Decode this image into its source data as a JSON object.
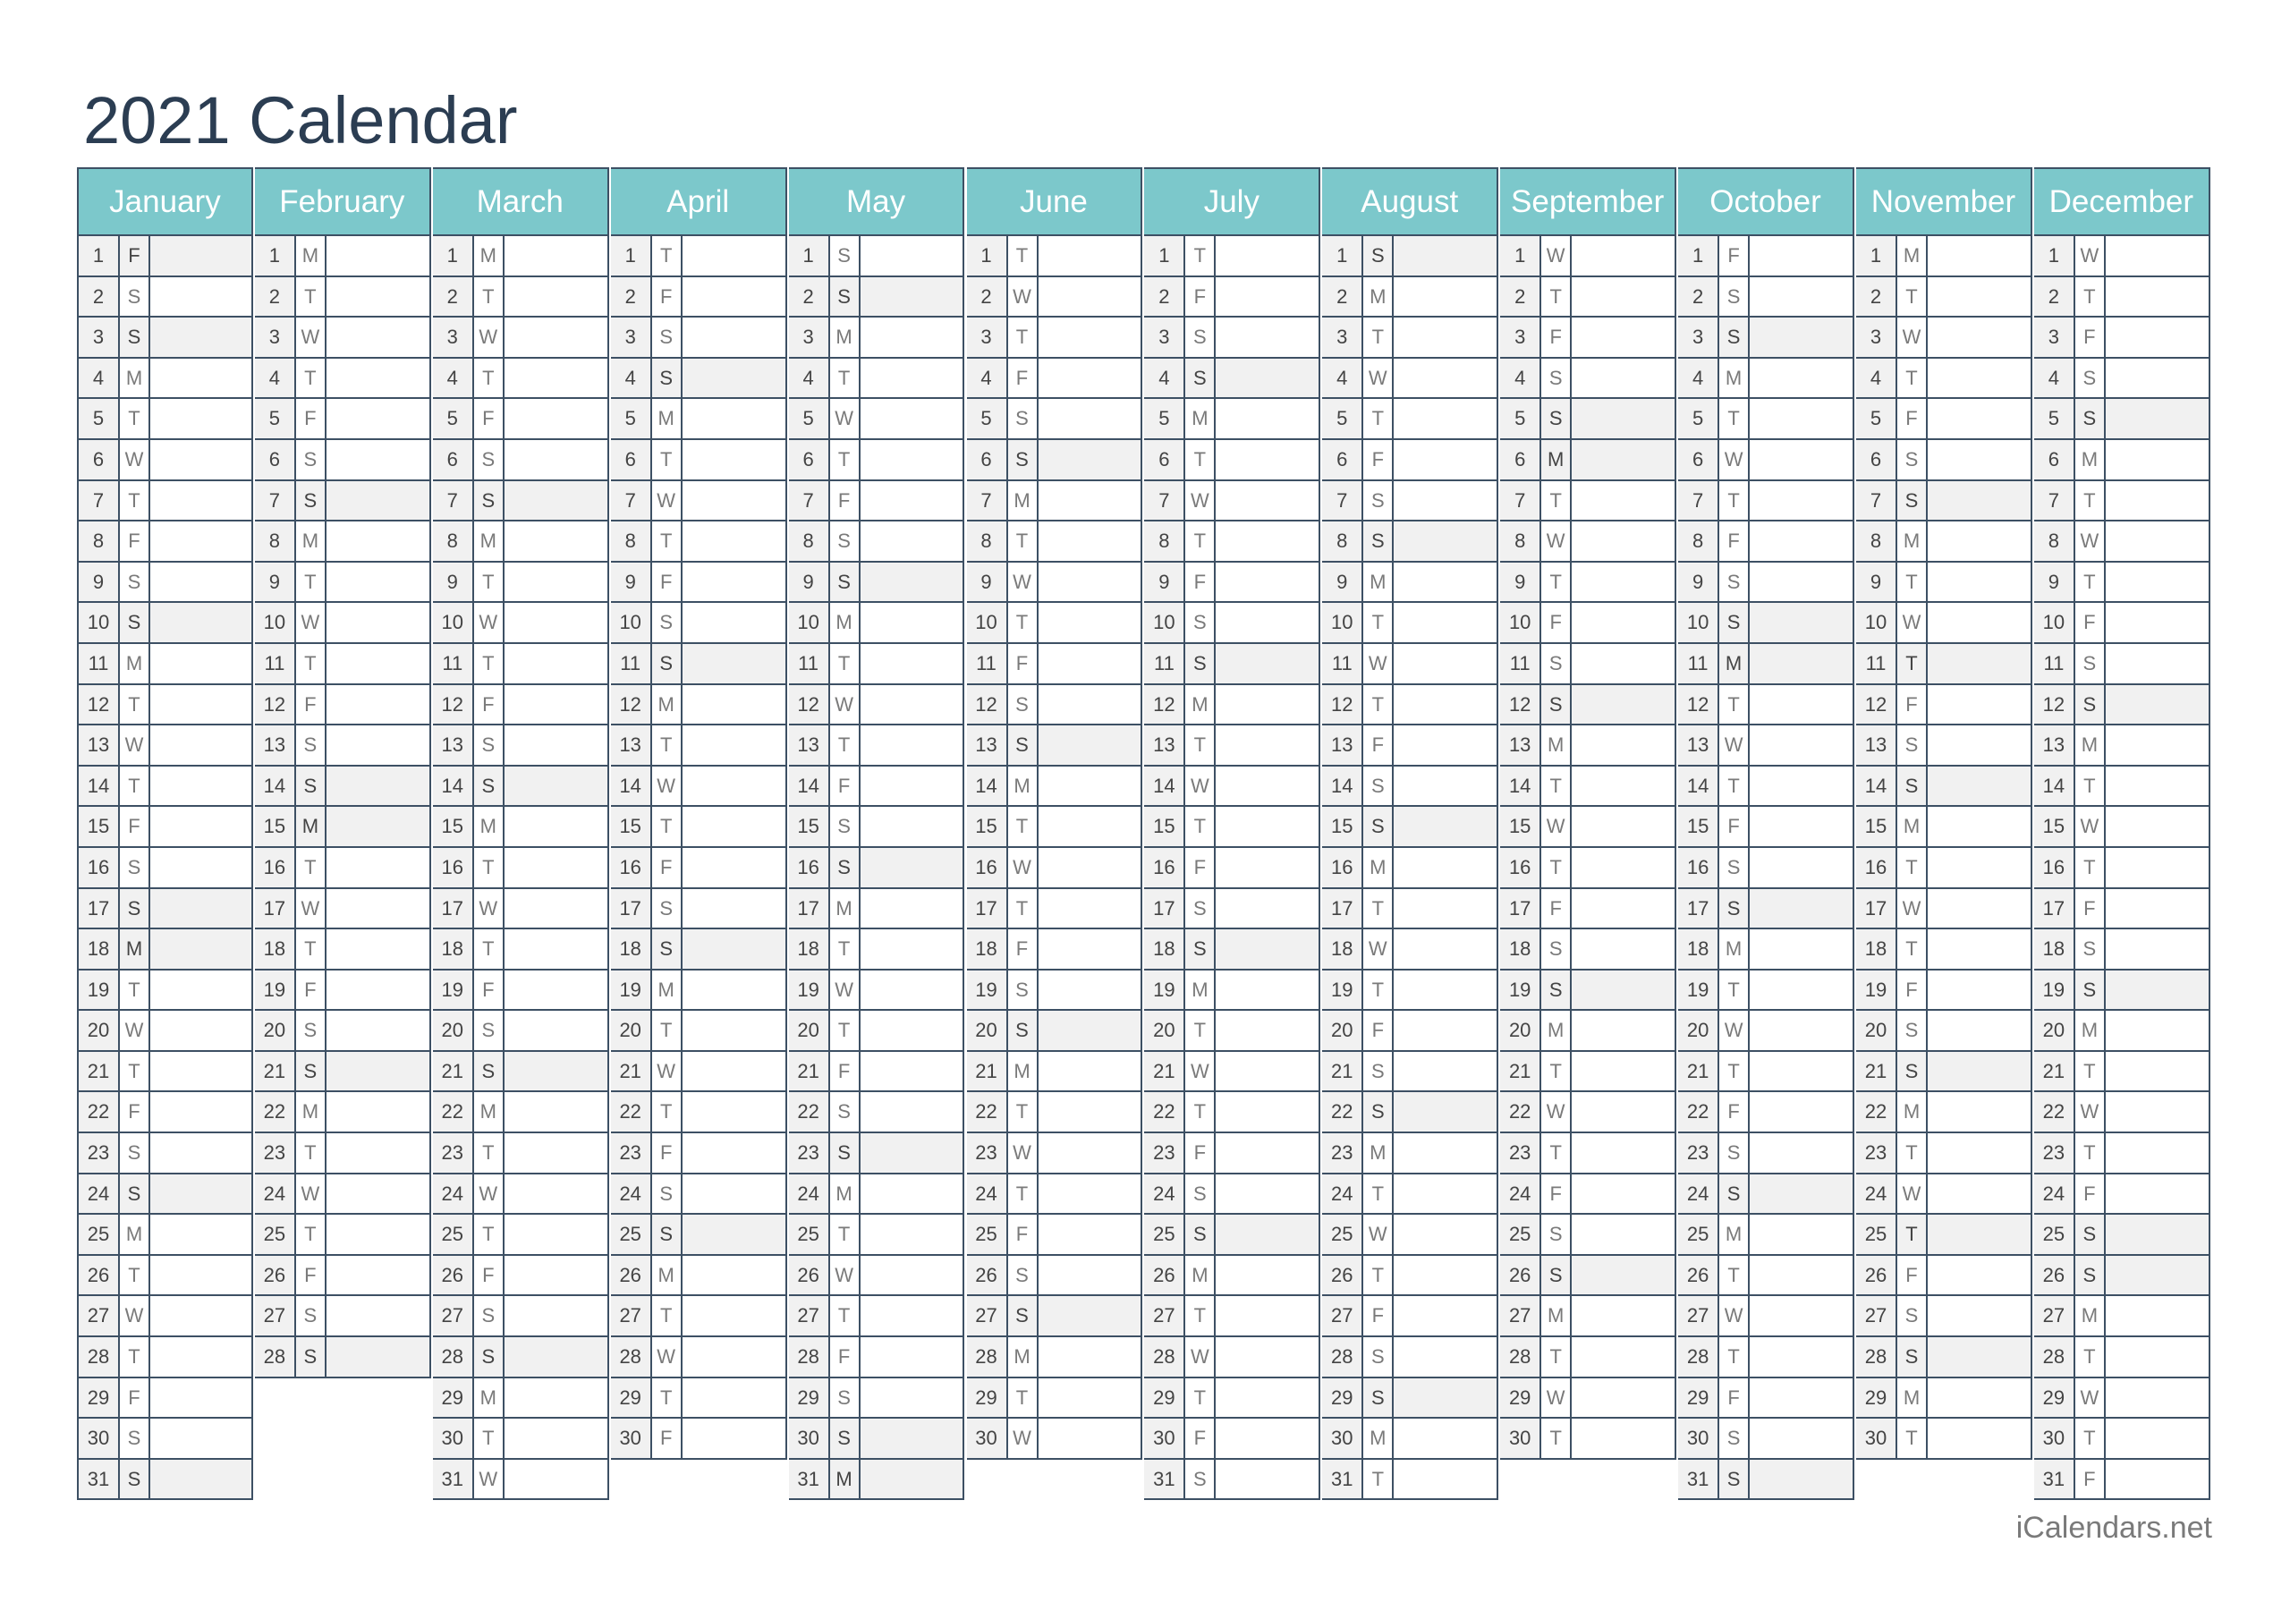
{
  "title": "2021 Calendar",
  "footer": "iCalendars.net",
  "colors": {
    "header_bg": "#7cc8cb",
    "header_text": "#ffffff",
    "title": "#2b3d52",
    "shaded_bg": "#f1f1f1",
    "border": "#3d5064"
  },
  "months": [
    {
      "name": "January",
      "first_weekday": "F",
      "length": 31,
      "shaded_days": [
        1,
        3,
        10,
        17,
        18,
        24,
        31
      ]
    },
    {
      "name": "February",
      "first_weekday": "M",
      "length": 28,
      "shaded_days": [
        7,
        14,
        15,
        21,
        28
      ]
    },
    {
      "name": "March",
      "first_weekday": "M",
      "length": 31,
      "shaded_days": [
        7,
        14,
        21,
        28
      ]
    },
    {
      "name": "April",
      "first_weekday": "T4",
      "length": 30,
      "shaded_days": [
        4,
        11,
        18,
        25
      ]
    },
    {
      "name": "May",
      "first_weekday": "S6",
      "length": 31,
      "shaded_days": [
        2,
        9,
        16,
        23,
        30,
        31
      ]
    },
    {
      "name": "June",
      "first_weekday": "T2",
      "length": 30,
      "shaded_days": [
        6,
        13,
        20,
        27
      ]
    },
    {
      "name": "July",
      "first_weekday": "T4",
      "length": 31,
      "shaded_days": [
        4,
        11,
        18,
        25
      ]
    },
    {
      "name": "August",
      "first_weekday": "S0",
      "length": 31,
      "shaded_days": [
        1,
        8,
        15,
        22,
        29
      ]
    },
    {
      "name": "September",
      "first_weekday": "W",
      "length": 30,
      "shaded_days": [
        5,
        6,
        12,
        19,
        26
      ]
    },
    {
      "name": "October",
      "first_weekday": "F",
      "length": 31,
      "shaded_days": [
        3,
        10,
        11,
        17,
        24,
        31
      ]
    },
    {
      "name": "November",
      "first_weekday": "M",
      "length": 30,
      "shaded_days": [
        7,
        11,
        14,
        21,
        25,
        28
      ]
    },
    {
      "name": "December",
      "first_weekday": "W",
      "length": 31,
      "shaded_days": [
        5,
        12,
        19,
        25,
        26
      ]
    }
  ],
  "weekday_letters": [
    "S",
    "M",
    "T",
    "W",
    "T",
    "F",
    "S"
  ],
  "month_start_index": [
    5,
    1,
    1,
    4,
    6,
    2,
    4,
    0,
    3,
    5,
    1,
    3
  ]
}
